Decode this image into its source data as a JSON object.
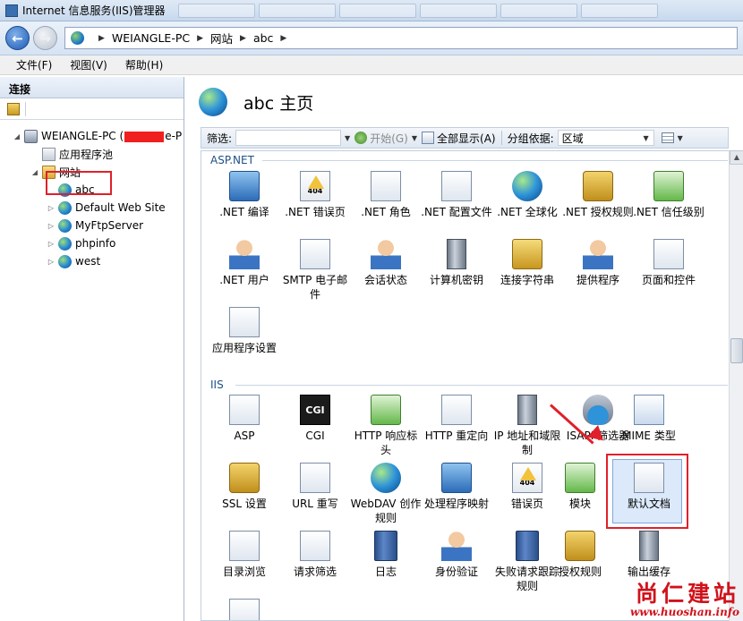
{
  "window": {
    "title": "Internet 信息服务(IIS)管理器"
  },
  "address_bar": {
    "crumbs": [
      "WEIANGLE-PC",
      "网站",
      "abc"
    ]
  },
  "menu": {
    "items": [
      "文件(F)",
      "视图(V)",
      "帮助(H)"
    ]
  },
  "left_panel": {
    "header": "连接",
    "tree": {
      "server_prefix": "WEIANGLE-PC (",
      "server_suffix": "e-P",
      "app_pool": "应用程序池",
      "sites_folder": "网站",
      "sites": [
        "abc",
        "Default Web Site",
        "MyFtpServer",
        "phpinfo",
        "west"
      ]
    }
  },
  "main": {
    "title": "abc 主页",
    "filterbar": {
      "filter_label": "筛选:",
      "start_label": "开始(G)",
      "show_all_label": "全部显示(A)",
      "group_by_label": "分组依据:",
      "group_by_value": "区域"
    },
    "sections": {
      "aspnet": {
        "label": "ASP.NET",
        "items": [
          ".NET 编译",
          ".NET 错误页",
          ".NET 角色",
          ".NET 配置文件",
          ".NET 全球化",
          ".NET 授权规则",
          ".NET 信任级别",
          ".NET 用户",
          "SMTP 电子邮件",
          "会话状态",
          "计算机密钥",
          "连接字符串",
          "提供程序",
          "页面和控件",
          "应用程序设置"
        ]
      },
      "iis": {
        "label": "IIS",
        "items": [
          "ASP",
          "CGI",
          "HTTP 响应标头",
          "HTTP 重定向",
          "IP 地址和域限制",
          "ISAPI 筛选器",
          "MIME 类型",
          "SSL 设置",
          "URL 重写",
          "WebDAV 创作规则",
          "处理程序映射",
          "错误页",
          "模块",
          "默认文档",
          "目录浏览",
          "请求筛选",
          "日志",
          "身份验证",
          "失败请求跟踪规则",
          "授权规则",
          "输出缓存"
        ]
      }
    },
    "icon_cgi_text": "CGI",
    "icon_404_text": "404"
  },
  "watermark": {
    "title": "尚仁建站",
    "url": "www.huoshan.info"
  },
  "colors": {
    "highlight_red": "#e0202a",
    "section_blue": "#1f4f87"
  }
}
